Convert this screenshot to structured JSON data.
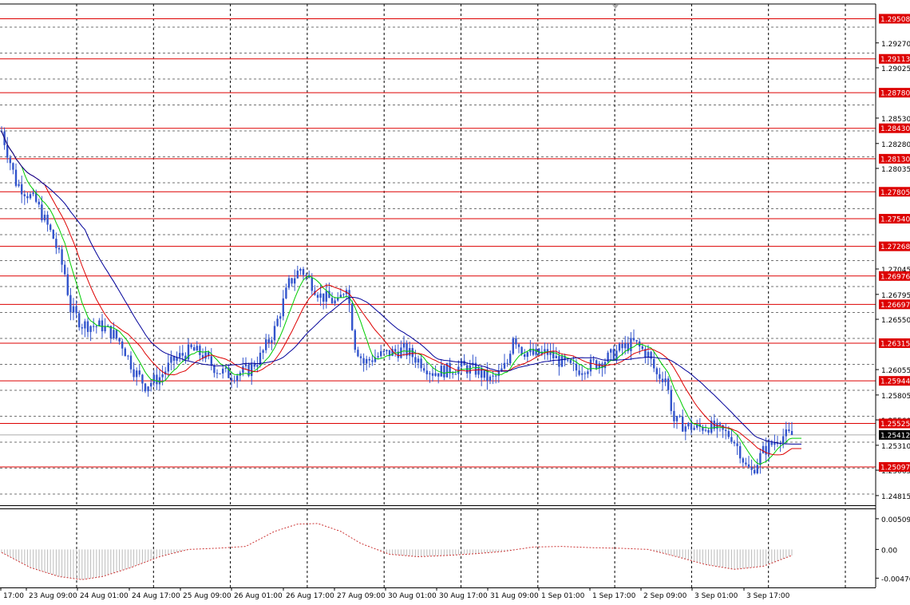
{
  "chart_data": {
    "type": "candlestick",
    "ylim": [
      1.2472,
      1.29653
    ],
    "osc_ylim": [
      -0.0063,
      0.0068
    ],
    "grid": true,
    "colors": {
      "candle": "#3355cc",
      "sma_fast": "#00cc00",
      "sma_mid": "#dd0000",
      "sma_slow": "#000099",
      "levels": "#dd0000",
      "osc_pos": "#cc3333",
      "osc_hist": "#bbbbbb",
      "grid": "#000000",
      "price_tag": "#000000"
    },
    "price_ticks": [
      "1.29270",
      "1.29025",
      "1.28530",
      "1.28280",
      "1.28035",
      "1.27045",
      "1.26795",
      "1.26550",
      "1.26055",
      "1.25805",
      "1.25560",
      "1.25310",
      "1.25065",
      "1.24815"
    ],
    "levels": [
      {
        "value": 1.29508,
        "label": "1.29508"
      },
      {
        "value": 1.29113,
        "label": "1.29113"
      },
      {
        "value": 1.2878,
        "label": "1.28780"
      },
      {
        "value": 1.2843,
        "label": "1.28430"
      },
      {
        "value": 1.2813,
        "label": "1.28130"
      },
      {
        "value": 1.27805,
        "label": "1.27805"
      },
      {
        "value": 1.2754,
        "label": "1.27540"
      },
      {
        "value": 1.27268,
        "label": "1.27268"
      },
      {
        "value": 1.26976,
        "label": "1.26976"
      },
      {
        "value": 1.26697,
        "label": "1.26697"
      },
      {
        "value": 1.26315,
        "label": "1.26315"
      },
      {
        "value": 1.25944,
        "label": "1.25944"
      },
      {
        "value": 1.25525,
        "label": "1.25525"
      },
      {
        "value": 1.25097,
        "label": "1.25097"
      }
    ],
    "current_price": {
      "value": 1.25412,
      "label": "1.25412"
    },
    "osc_ticks": [
      {
        "value": 0.00509,
        "label": "0.00509"
      },
      {
        "value": 0.0,
        "label": "0.00"
      },
      {
        "value": -0.00476,
        "label": "-0.00476"
      }
    ],
    "time_labels": [
      "17:00",
      "23 Aug 09:00",
      "24 Aug 01:00",
      "24 Aug 17:00",
      "25 Aug 09:00",
      "26 Aug 01:00",
      "26 Aug 17:00",
      "27 Aug 09:00",
      "30 Aug 01:00",
      "30 Aug 17:00",
      "31 Aug 09:00",
      "1 Sep 01:00",
      "1 Sep 17:00",
      "2 Sep 09:00",
      "3 Sep 01:00",
      "3 Sep 17:00"
    ],
    "price_anchors": [
      [
        0,
        1.284
      ],
      [
        5,
        1.279
      ],
      [
        12,
        1.277
      ],
      [
        18,
        1.2735
      ],
      [
        22,
        1.27
      ],
      [
        24,
        1.2665
      ],
      [
        28,
        1.265
      ],
      [
        35,
        1.2648
      ],
      [
        39,
        1.264
      ],
      [
        42,
        1.263
      ],
      [
        46,
        1.2605
      ],
      [
        50,
        1.259
      ],
      [
        55,
        1.2598
      ],
      [
        60,
        1.2615
      ],
      [
        66,
        1.2625
      ],
      [
        70,
        1.262
      ],
      [
        75,
        1.2605
      ],
      [
        80,
        1.26
      ],
      [
        86,
        1.2605
      ],
      [
        90,
        1.2618
      ],
      [
        95,
        1.2645
      ],
      [
        100,
        1.269
      ],
      [
        104,
        1.2705
      ],
      [
        108,
        1.269
      ],
      [
        111,
        1.2678
      ],
      [
        114,
        1.2675
      ],
      [
        117,
        1.267
      ],
      [
        120,
        1.269
      ],
      [
        123,
        1.263
      ],
      [
        126,
        1.2612
      ],
      [
        130,
        1.2618
      ],
      [
        135,
        1.2622
      ],
      [
        140,
        1.2625
      ],
      [
        145,
        1.2615
      ],
      [
        150,
        1.2603
      ],
      [
        155,
        1.2605
      ],
      [
        160,
        1.2608
      ],
      [
        165,
        1.2605
      ],
      [
        170,
        1.2595
      ],
      [
        173,
        1.26
      ],
      [
        176,
        1.2612
      ],
      [
        178,
        1.264
      ],
      [
        181,
        1.2625
      ],
      [
        185,
        1.262
      ],
      [
        190,
        1.2622
      ],
      [
        195,
        1.2612
      ],
      [
        200,
        1.2605
      ],
      [
        205,
        1.261
      ],
      [
        210,
        1.2615
      ],
      [
        215,
        1.2625
      ],
      [
        220,
        1.2632
      ],
      [
        225,
        1.262
      ],
      [
        228,
        1.26
      ],
      [
        231,
        1.2598
      ],
      [
        234,
        1.2555
      ],
      [
        238,
        1.255
      ],
      [
        242,
        1.2548
      ],
      [
        246,
        1.255
      ],
      [
        250,
        1.2545
      ],
      [
        254,
        1.254
      ],
      [
        257,
        1.2525
      ],
      [
        259,
        1.251
      ],
      [
        261,
        1.2505
      ],
      [
        263,
        1.2515
      ],
      [
        265,
        1.2525
      ],
      [
        268,
        1.2532
      ],
      [
        271,
        1.254
      ],
      [
        275,
        1.2541
      ]
    ],
    "osc_anchors": [
      [
        0,
        -0.0005
      ],
      [
        10,
        -0.003
      ],
      [
        20,
        -0.0045
      ],
      [
        28,
        -0.005
      ],
      [
        35,
        -0.0045
      ],
      [
        45,
        -0.003
      ],
      [
        55,
        -0.0012
      ],
      [
        65,
        0.0
      ],
      [
        75,
        0.0002
      ],
      [
        85,
        0.0005
      ],
      [
        95,
        0.003
      ],
      [
        103,
        0.0042
      ],
      [
        110,
        0.0043
      ],
      [
        118,
        0.003
      ],
      [
        125,
        0.001
      ],
      [
        135,
        -0.0008
      ],
      [
        145,
        -0.0012
      ],
      [
        155,
        -0.001
      ],
      [
        165,
        -0.0007
      ],
      [
        175,
        -0.0003
      ],
      [
        185,
        0.0004
      ],
      [
        195,
        0.0005
      ],
      [
        205,
        0.0003
      ],
      [
        215,
        0.0002
      ],
      [
        225,
        0.0
      ],
      [
        235,
        -0.0012
      ],
      [
        245,
        -0.0025
      ],
      [
        255,
        -0.0033
      ],
      [
        265,
        -0.0028
      ],
      [
        275,
        -0.001
      ]
    ]
  }
}
